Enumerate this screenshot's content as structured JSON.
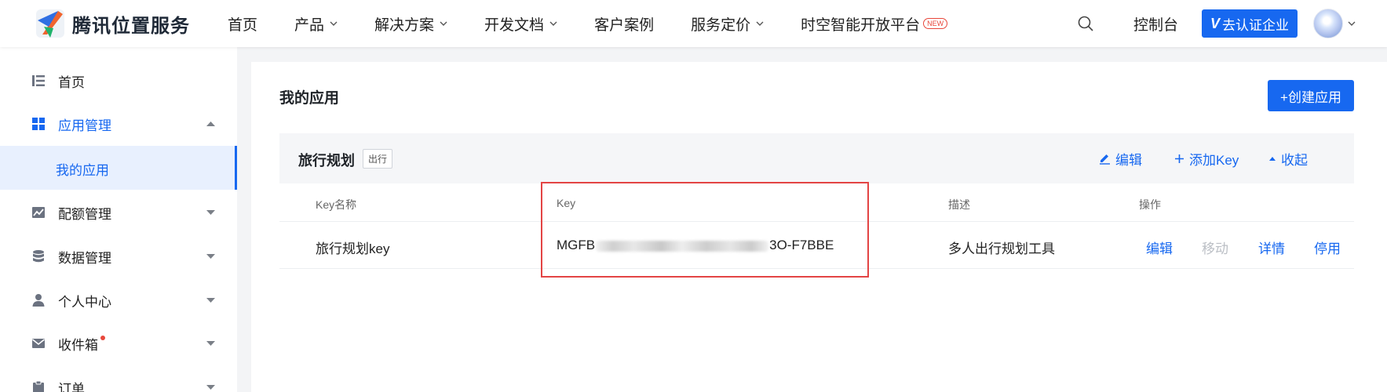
{
  "brand": {
    "name": "腾讯位置服务"
  },
  "nav": {
    "items": [
      {
        "label": "首页",
        "has_dropdown": false
      },
      {
        "label": "产品",
        "has_dropdown": true
      },
      {
        "label": "解决方案",
        "has_dropdown": true
      },
      {
        "label": "开发文档",
        "has_dropdown": true
      },
      {
        "label": "客户案例",
        "has_dropdown": false
      },
      {
        "label": "服务定价",
        "has_dropdown": true
      },
      {
        "label": "时空智能开放平台",
        "has_dropdown": false,
        "badge": "NEW"
      }
    ],
    "console": "控制台",
    "certify": "去认证企业"
  },
  "sidebar": {
    "items": [
      {
        "label": "首页",
        "icon": "list-icon"
      },
      {
        "label": "应用管理",
        "icon": "grid-icon",
        "active": true,
        "expanded": true
      },
      {
        "label": "配额管理",
        "icon": "chart-icon"
      },
      {
        "label": "数据管理",
        "icon": "database-icon"
      },
      {
        "label": "个人中心",
        "icon": "user-icon"
      },
      {
        "label": "收件箱",
        "icon": "mail-icon",
        "unread_dot": true
      },
      {
        "label": "订单",
        "icon": "clipboard-icon"
      }
    ],
    "sub_item": "我的应用"
  },
  "main": {
    "title": "我的应用",
    "create_button": "+创建应用",
    "app": {
      "name": "旅行规划",
      "tag": "出行",
      "actions": {
        "edit": "编辑",
        "add_key": "添加Key",
        "collapse": "收起"
      },
      "columns": [
        "Key名称",
        "Key",
        "描述",
        "操作"
      ],
      "rows": [
        {
          "key_name": "旅行规划key",
          "key_prefix": "MGFB",
          "key_suffix": "3O-F7BBE",
          "description": "多人出行规划工具",
          "actions": {
            "edit": "编辑",
            "move": "移动",
            "details": "详情",
            "disable": "停用"
          }
        }
      ]
    }
  },
  "colors": {
    "primary": "#1768f0",
    "highlight": "#e34444",
    "badge": "#e8473b"
  }
}
